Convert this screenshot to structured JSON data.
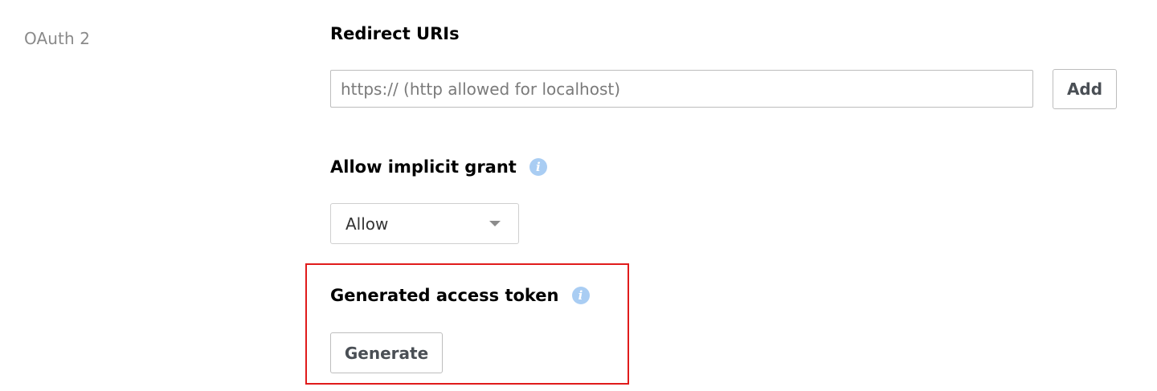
{
  "section": {
    "label": "OAuth 2"
  },
  "redirect_uris": {
    "title": "Redirect URIs",
    "input_value": "",
    "input_placeholder": "https:// (http allowed for localhost)",
    "add_label": "Add"
  },
  "implicit_grant": {
    "title": "Allow implicit grant",
    "info_icon": "info-icon",
    "selected_value": "Allow"
  },
  "access_token": {
    "title": "Generated access token",
    "info_icon": "info-icon",
    "generate_label": "Generate"
  },
  "colors": {
    "highlight_border": "#e01b1b",
    "info_icon_bg": "#a9cdf3",
    "section_label": "#8a8a8a"
  }
}
